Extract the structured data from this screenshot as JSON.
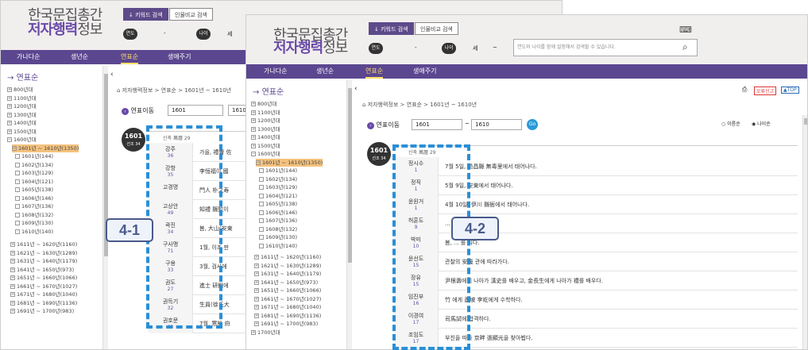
{
  "site": {
    "title_line1": "한국문집총간",
    "title_line2a": "저자행력",
    "title_line2b": "정보"
  },
  "header": {
    "keyword_search": "키워드 검색",
    "person_compare": "인물비교 검색",
    "year_pill": "연도",
    "age_pill": "나이",
    "dash": "-",
    "age_suffix": "세",
    "tilde": "~",
    "search_placeholder": "연도와 나이를 함께 설정해서 검색할 수 있습니다."
  },
  "nav": [
    "가나다순",
    "생년순",
    "연표순",
    "생애주기"
  ],
  "sidebar": {
    "heading": "연표순",
    "tree_back": [
      "800년대",
      "1100년대",
      "1200년대",
      "1300년대",
      "1400년대",
      "1500년대",
      "1600년대"
    ],
    "selected": "1601년 ~ 1610년(1350)",
    "years": [
      "1601년(144)",
      "1602년(134)",
      "1603년(129)",
      "1604년(121)",
      "1605년(138)",
      "1606년(146)",
      "1607년(136)",
      "1608년(132)",
      "1609년(130)",
      "1610년(140)"
    ],
    "decades_back": [
      "1611년 ~ 1620년(1160)",
      "1621년 ~ 1630년(1289)",
      "1631년 ~ 1640년(1179)",
      "1641년 ~ 1650년(973)",
      "1651년 ~ 1660년(1066)",
      "1661년 ~ 1670년(1027)",
      "1671년 ~ 1680년(1040)",
      "1681년 ~ 1690년(1136)",
      "1691년 ~ 1700년(983)"
    ],
    "decades_front": [
      "1611년 ~ 1620년(1160)",
      "1621년 ~ 1630년(1289)",
      "1631년 ~ 1640년(1179)",
      "1641년 ~ 1650년(973)",
      "1651년 ~ 1660년(1066)",
      "1661년 ~ 1670년(1027)",
      "1671년 ~ 1680년(1040)",
      "1681년 ~ 1690년(1136)",
      "1691년 ~ 1700년(983)"
    ],
    "more": "1700년대"
  },
  "main": {
    "crumb": "저자행력정보 > 연표순 > 1601년 ~ 1610년",
    "move_label": "연표이동",
    "from": "1601",
    "to": "1610",
    "go": "Go",
    "sort1": "이름순",
    "sort2": "나이순",
    "print": "오류신고",
    "top": "TOP",
    "year": "1601",
    "reign": "선조 34",
    "era_header": "신축  萬曆 29",
    "back_rows": [
      {
        "name": "강주",
        "age": "36",
        "desc": "가을, 禮曹 佐"
      },
      {
        "name": "강항",
        "age": "35",
        "desc": "李恒福이 國"
      },
      {
        "name": "고경명",
        "age": "",
        "desc": "門人 朴之寿"
      },
      {
        "name": "고상안",
        "age": "49",
        "desc": "知禮 縣監이"
      },
      {
        "name": "곽진",
        "age": "34",
        "desc": "봄, 大山(安東"
      },
      {
        "name": "구사맹",
        "age": "71",
        "desc": "1월, 이조 판"
      },
      {
        "name": "구용",
        "age": "33",
        "desc": "3월, 검사에"
      },
      {
        "name": "권도",
        "age": "27",
        "desc": "進士 研鍛에"
      },
      {
        "name": "권득기",
        "age": "32",
        "desc": "生員(徐氏大"
      },
      {
        "name": "권호문",
        "age": "63",
        "desc": "7월, 寒松 府"
      }
    ],
    "front_rows": [
      {
        "name": "정시수",
        "age": "1",
        "desc": "7월 5일, 邑昌縣 無毒里에서 태어나다."
      },
      {
        "name": "정직",
        "age": "1",
        "desc": "5월 9일, 安東에서 태어나다."
      },
      {
        "name": "윤원거",
        "age": "1",
        "desc": "4월 10일, 伊川 縣衙에서 태어나다."
      },
      {
        "name": "허훈도",
        "age": "9",
        "desc": "... 로 돌아오다."
      },
      {
        "name": "박미",
        "age": "10",
        "desc": "봄, ... 를 읽다."
      },
      {
        "name": "윤선도",
        "age": "15",
        "desc": "관찰의 安邊 관에 따라가다."
      },
      {
        "name": "장유",
        "age": "15",
        "desc": "尹根壽에게 나아가 漢史를 배우고, 金長生에게 나아가 禮를 배우다."
      },
      {
        "name": "임진부",
        "age": "16",
        "desc": "竹 에게 蘆坡 李屹에게 수학하다."
      },
      {
        "name": "이경여",
        "age": "17",
        "desc": "司馬試에 합격하다."
      },
      {
        "name": "조임도",
        "age": "17",
        "desc": "부친을 따라 京畔 張顯光을 찾아뵙다."
      }
    ]
  },
  "callouts": {
    "left": "4-1",
    "right": "4-2"
  }
}
